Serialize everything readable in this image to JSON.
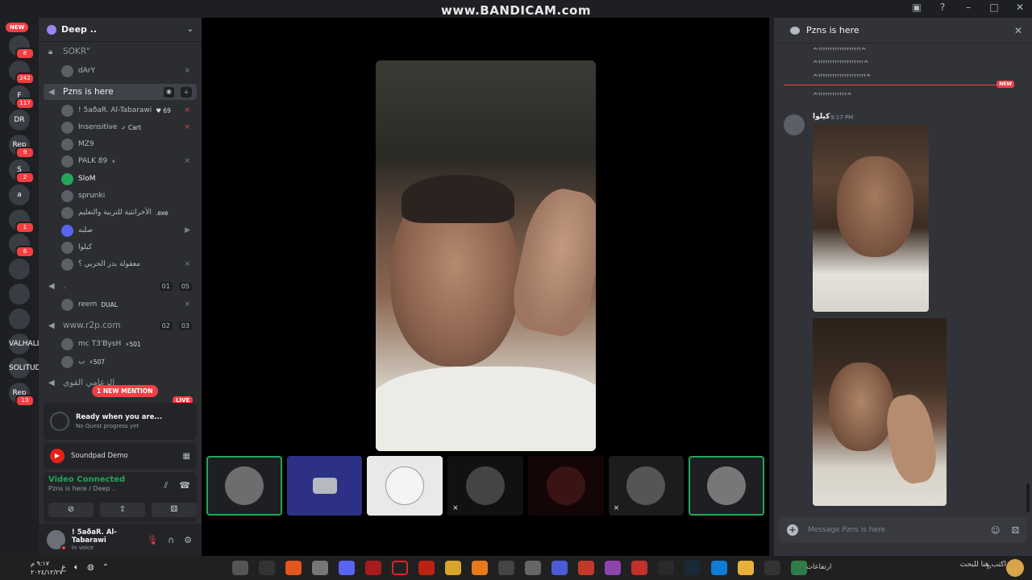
{
  "recording": {
    "watermark": "www.BANDICAM.com"
  },
  "rail": {
    "new_pill": "NEW",
    "servers": [
      {
        "label": "",
        "badge": "8"
      },
      {
        "label": "",
        "badge": "242"
      },
      {
        "label": "F",
        "badge": "117"
      },
      {
        "label": "DR",
        "badge": ""
      },
      {
        "label": "Rep",
        "badge": "9"
      },
      {
        "label": "S",
        "badge": "2"
      },
      {
        "label": "a",
        "badge": ""
      },
      {
        "label": "",
        "badge": "1"
      },
      {
        "label": "",
        "badge": "6"
      },
      {
        "label": "",
        "badge": ""
      },
      {
        "label": "",
        "badge": ""
      },
      {
        "label": "",
        "badge": ""
      },
      {
        "label": "VALHALLA",
        "badge": ""
      },
      {
        "label": "SOLITUDE",
        "badge": ""
      },
      {
        "label": "Rep",
        "badge": "13"
      }
    ]
  },
  "sidebar": {
    "guild_name": "Deep ..",
    "channels": [
      {
        "name": "SOKR\"",
        "type": "locked",
        "active": false,
        "counts": []
      },
      {
        "name": "Pzns is here",
        "type": "voice",
        "active": true,
        "counts": []
      },
      {
        "name": ".",
        "type": "voice",
        "active": false,
        "counts": [
          "01",
          "05"
        ]
      },
      {
        "name": "www.r2p.com",
        "type": "voice",
        "active": false,
        "counts": [
          "02",
          "03"
        ]
      },
      {
        "name": "الزعامي القوي",
        "type": "voice",
        "active": false,
        "counts": []
      }
    ],
    "voice_users": [
      {
        "name": "dArY",
        "tag": "",
        "status": "⨯"
      },
      {
        "name": "! 5aðaR. Al-Tabarawi",
        "tag": "♥ 69",
        "status": "⨯"
      },
      {
        "name": "Insensitive",
        "tag": "✓ Cart",
        "status": "⨯"
      },
      {
        "name": "MZ9",
        "tag": "",
        "status": ""
      },
      {
        "name": "PALK 89",
        "tag": "⚡",
        "status": "⨯"
      },
      {
        "name": "SloM",
        "tag": "",
        "status": ""
      },
      {
        "name": "sprunki",
        "tag": "",
        "status": ""
      },
      {
        "name": "الأخرانثية للتربية والتعليم",
        "tag": ".exe",
        "status": ""
      },
      {
        "name": "صلبه",
        "tag": "",
        "status": "▶"
      },
      {
        "name": "كيلوا",
        "tag": "",
        "status": ""
      },
      {
        "name": "معقولة بدر الحربي ؟",
        "tag": "",
        "status": "⨯"
      },
      {
        "name": "reem",
        "tag": "DUAL",
        "status": "⨯"
      },
      {
        "name": "mc T3'BysH",
        "tag": "⚡501",
        "status": ""
      },
      {
        "name": "ب",
        "tag": "⚡507",
        "status": ""
      }
    ],
    "mention_pill": "1 NEW MENTION",
    "live_pill": "LIVE"
  },
  "quest": {
    "title": "Ready when you are...",
    "subtitle": "No Quest progress yet"
  },
  "soundpad": {
    "label": "Soundpad Demo"
  },
  "voice_connection": {
    "status": "Video Connected",
    "location": "Pzns is here / Deep .."
  },
  "user": {
    "name": "! 5aðaR. Al-Tabarawi",
    "status": "In voice"
  },
  "chat": {
    "channel": "Pzns is here",
    "messages_prev": [
      "^ꜛꜛꜛꜛꜛꜛꜛꜛꜛꜛꜛꜛꜛꜛꜛꜛꜛꜛ^",
      "^ꜛꜛꜛꜛꜛꜛꜛꜛꜛꜛꜛꜛꜛꜛꜛꜛꜛꜛꜛ^",
      "^ꜛꜛꜛꜛꜛꜛꜛꜛꜛꜛꜛꜛꜛꜛꜛꜛꜛꜛꜛꜛ^",
      "^ꜛꜛꜛꜛꜛꜛꜛꜛꜛꜛꜛꜛ^"
    ],
    "new_divider": "NEW",
    "author": "كيلوا",
    "time": "9:17 PM",
    "input_placeholder": "Message Pzns is here"
  },
  "taskbar": {
    "time": "٩:١٧ م",
    "date": "٢٠٢٤/١٢/٢٧",
    "lang": "ع",
    "search_placeholder": "اكتب هنا للبحث",
    "news": "ارتفاعات"
  }
}
